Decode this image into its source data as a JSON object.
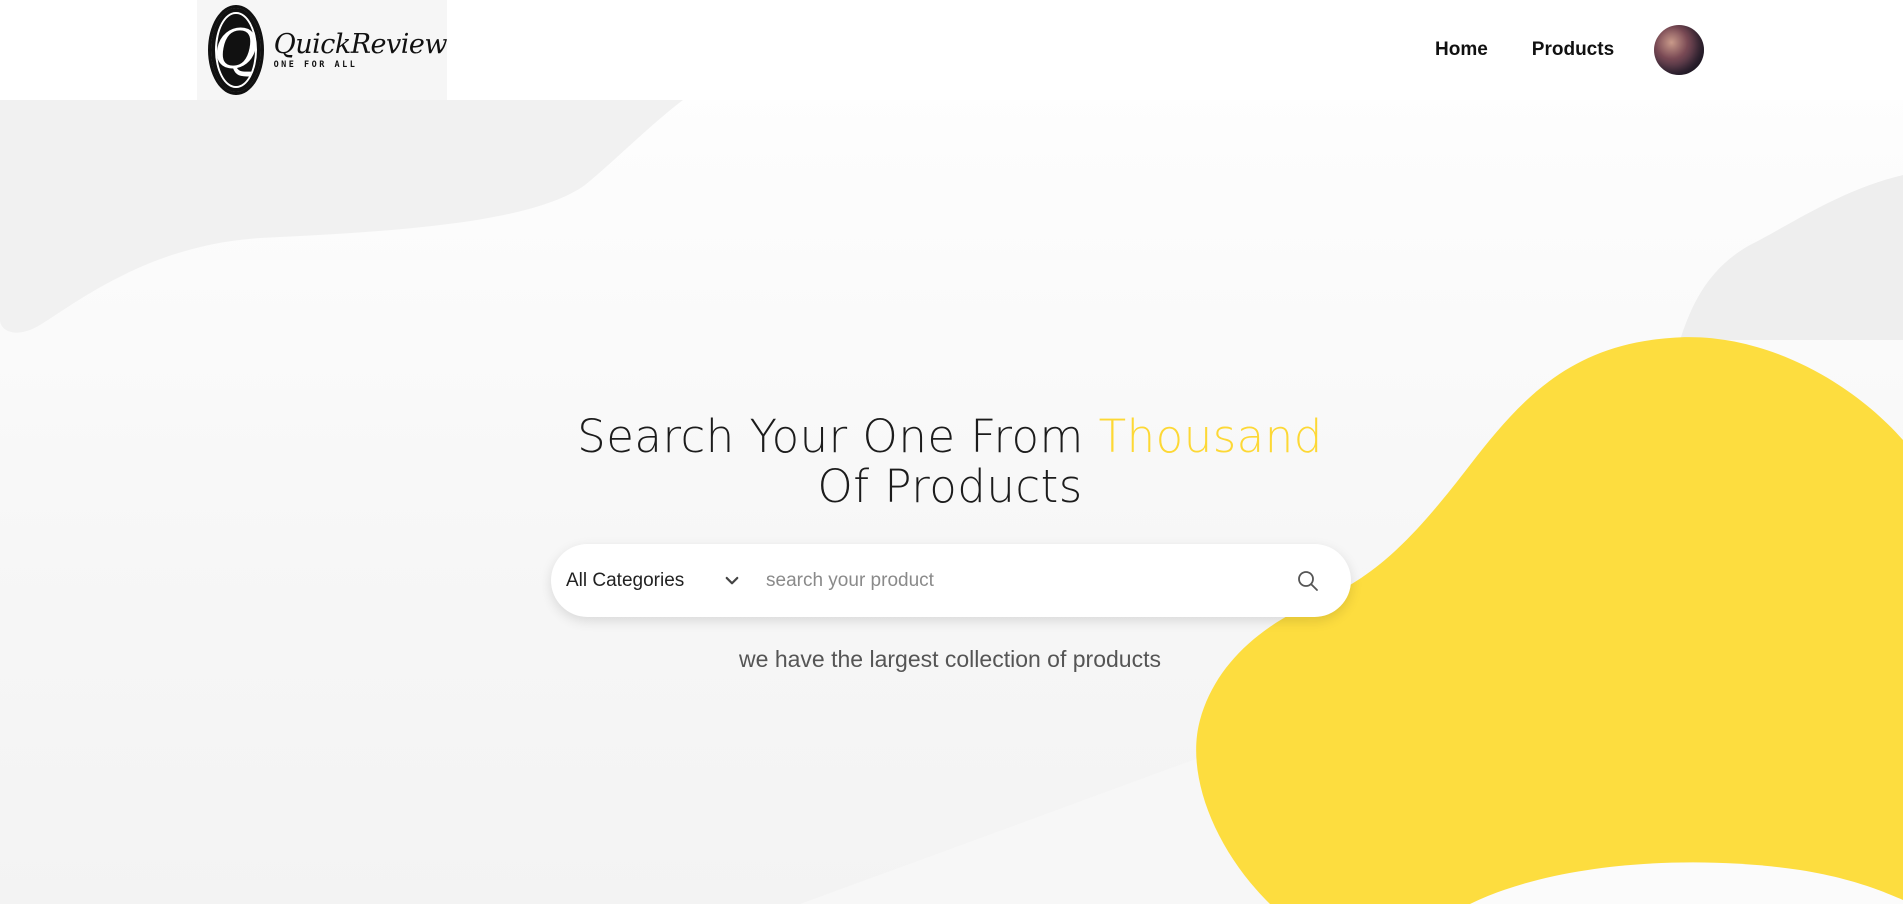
{
  "header": {
    "logo": {
      "mark": "Q",
      "name": "QuickReview",
      "tagline": "ONE FOR ALL"
    },
    "nav": [
      {
        "label": "Home"
      },
      {
        "label": "Products"
      }
    ],
    "avatar_icon": "user-avatar"
  },
  "hero": {
    "headline": {
      "before": "Search Your One From ",
      "accent": "Thousand",
      "after": " Of Products"
    },
    "search": {
      "category_selected": "All Categories",
      "placeholder": "search your product",
      "value": "",
      "dropdown_icon": "chevron-down-icon",
      "submit_icon": "search-icon"
    },
    "subline": "we have the largest collection of products"
  },
  "colors": {
    "accent": "#fdd835",
    "blob_yellow": "#fddd3f",
    "blob_gray": "#efefef",
    "text": "#1c1c1c"
  }
}
